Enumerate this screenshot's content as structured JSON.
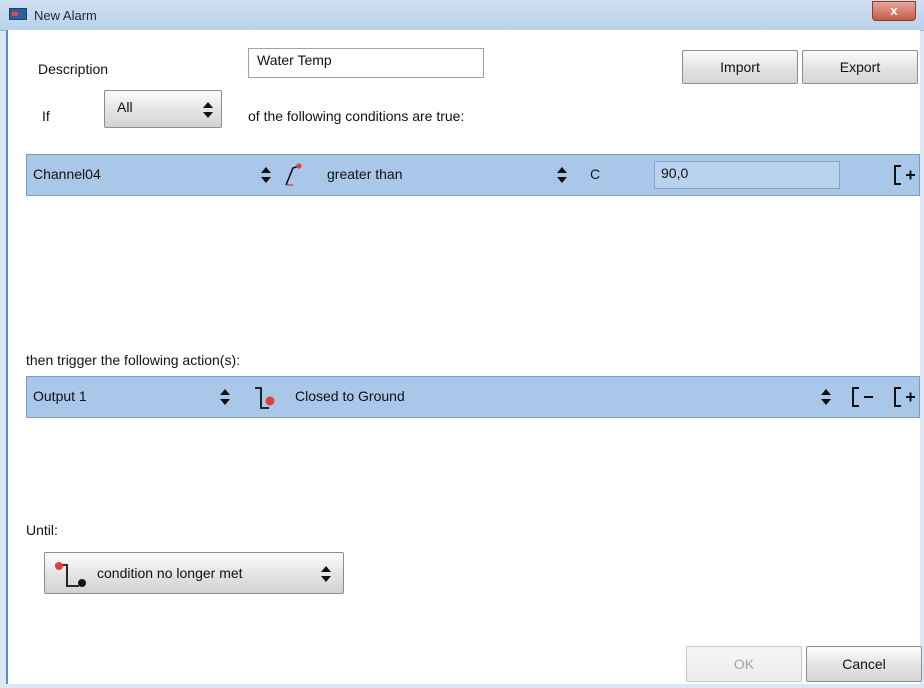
{
  "window": {
    "title": "New Alarm",
    "close_glyph": "x",
    "icon": "app-icon"
  },
  "form": {
    "description_label": "Description",
    "description_value": "Water Temp",
    "if_label": "If",
    "match_selected": "All",
    "conditions_text": "of the following conditions are true:",
    "import_label": "Import",
    "export_label": "Export"
  },
  "condition_rows": [
    {
      "channel": "Channel04",
      "edge_icon": "rising-edge-icon",
      "operator": "greater than",
      "unit": "C",
      "value": "90,0",
      "add_icon": "add-row-icon"
    }
  ],
  "actions": {
    "label": "then trigger the following action(s):",
    "rows": [
      {
        "output": "Output 1",
        "state_icon": "closed-to-ground-icon",
        "state": "Closed to Ground",
        "remove_icon": "remove-row-icon",
        "add_icon": "add-row-icon"
      }
    ]
  },
  "until": {
    "label": "Until:",
    "selected": "condition no longer met",
    "icon": "condition-release-icon"
  },
  "footer": {
    "ok_label": "OK",
    "cancel_label": "Cancel",
    "ok_disabled": true
  },
  "colors": {
    "row_bg": "#a9c7e8",
    "accent_red": "#e3403a",
    "window_frame": "#7fa9cf"
  }
}
